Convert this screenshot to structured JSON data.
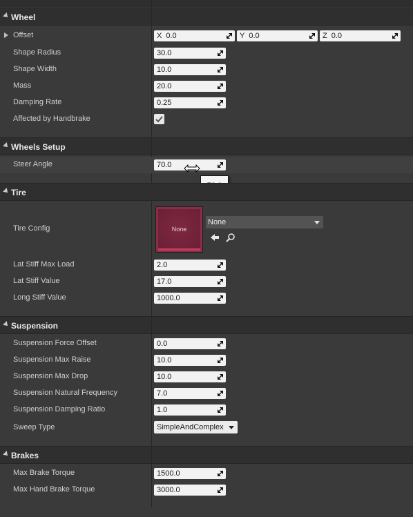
{
  "sections": {
    "wheel": "Wheel",
    "wheels_setup": "Wheels Setup",
    "tire": "Tire",
    "suspension": "Suspension",
    "brakes": "Brakes"
  },
  "wheel": {
    "offset": {
      "label": "Offset",
      "x_axis": "X",
      "x": "0.0",
      "y_axis": "Y",
      "y": "0.0",
      "z_axis": "Z",
      "z": "0.0"
    },
    "shape_radius": {
      "label": "Shape Radius",
      "value": "30.0"
    },
    "shape_width": {
      "label": "Shape Width",
      "value": "10.0"
    },
    "mass": {
      "label": "Mass",
      "value": "20.0"
    },
    "damping_rate": {
      "label": "Damping Rate",
      "value": "0.25"
    },
    "affected_by_handbrake": {
      "label": "Affected by Handbrake",
      "checked": true
    }
  },
  "wheels_setup": {
    "steer_angle": {
      "label": "Steer Angle",
      "value": "70.0",
      "tooltip": "70.0"
    }
  },
  "tire": {
    "tire_config": {
      "label": "Tire Config",
      "thumbnail_text": "None",
      "selected": "None"
    },
    "lat_stiff_max_load": {
      "label": "Lat Stiff Max Load",
      "value": "2.0"
    },
    "lat_stiff_value": {
      "label": "Lat Stiff Value",
      "value": "17.0"
    },
    "long_stiff_value": {
      "label": "Long Stiff Value",
      "value": "1000.0"
    }
  },
  "suspension": {
    "force_offset": {
      "label": "Suspension Force Offset",
      "value": "0.0"
    },
    "max_raise": {
      "label": "Suspension Max Raise",
      "value": "10.0"
    },
    "max_drop": {
      "label": "Suspension Max Drop",
      "value": "10.0"
    },
    "natural_frequency": {
      "label": "Suspension Natural Frequency",
      "value": "7.0"
    },
    "damping_ratio": {
      "label": "Suspension Damping Ratio",
      "value": "1.0"
    },
    "sweep_type": {
      "label": "Sweep Type",
      "value": "SimpleAndComplex"
    }
  },
  "brakes": {
    "max_brake_torque": {
      "label": "Max Brake Torque",
      "value": "1500.0"
    },
    "max_hand_brake_torque": {
      "label": "Max Hand Brake Torque",
      "value": "3000.0"
    }
  },
  "icons": {
    "drag_handle": "drag-handle-icon",
    "use_selected": "arrow-left-icon",
    "browse": "search-icon"
  },
  "colors": {
    "panel_bg": "#3a3a3a",
    "section_bg": "#2f2f2f",
    "field_bg": "#f2f2f2",
    "asset_thumb": "#8a2d46"
  }
}
